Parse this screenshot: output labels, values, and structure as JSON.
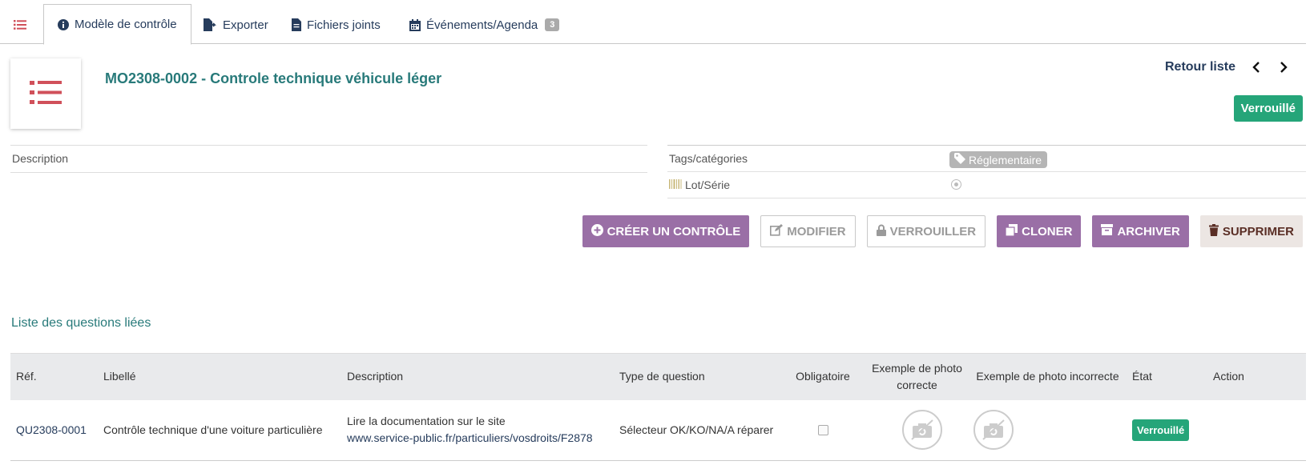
{
  "tabs": [
    {
      "label": "",
      "icon": "list-icon"
    },
    {
      "label": "Modèle de contrôle",
      "icon": "info-circle-icon"
    },
    {
      "label": "Exporter",
      "icon": "file-export-icon"
    },
    {
      "label": "Fichiers joints",
      "icon": "file-icon"
    },
    {
      "label": "Événements/Agenda",
      "icon": "calendar-icon",
      "count": "3"
    }
  ],
  "header": {
    "ref_title": "MO2308-0002 - Controle technique véhicule léger",
    "back_label": "Retour liste",
    "status": "Verrouillé"
  },
  "fields": {
    "description_label": "Description",
    "tags_label": "Tags/catégories",
    "tag_value": "Réglementaire",
    "lot_label": "Lot/Série"
  },
  "actions": {
    "create": "CRÉER UN CONTRÔLE",
    "modify": "MODIFIER",
    "lock": "VERROUILLER",
    "clone": "CLONER",
    "archive": "ARCHIVER",
    "delete": "SUPPRIMER"
  },
  "section_title": "Liste des questions liées",
  "table": {
    "headers": [
      "Réf.",
      "Libellé",
      "Description",
      "Type de question",
      "Obligatoire",
      "Exemple de photo correcte",
      "Exemple de photo incorrecte",
      "État",
      "Action"
    ],
    "rows": [
      {
        "ref": "QU2308-0001",
        "label": "Contrôle technique d'une voiture particulière",
        "desc_text": "Lire la documentation sur le site",
        "desc_link": "www.service-public.fr/particuliers/vosdroits/F2878",
        "type": "Sélecteur OK/KO/NA/A réparer",
        "mandatory": false,
        "status": "Verrouillé"
      }
    ]
  },
  "colors": {
    "accent_teal": "#287a7a",
    "navy": "#263c5c",
    "status_green": "#25a579",
    "action_purple": "#9a6fa6",
    "logo_red": "#d0505a"
  }
}
